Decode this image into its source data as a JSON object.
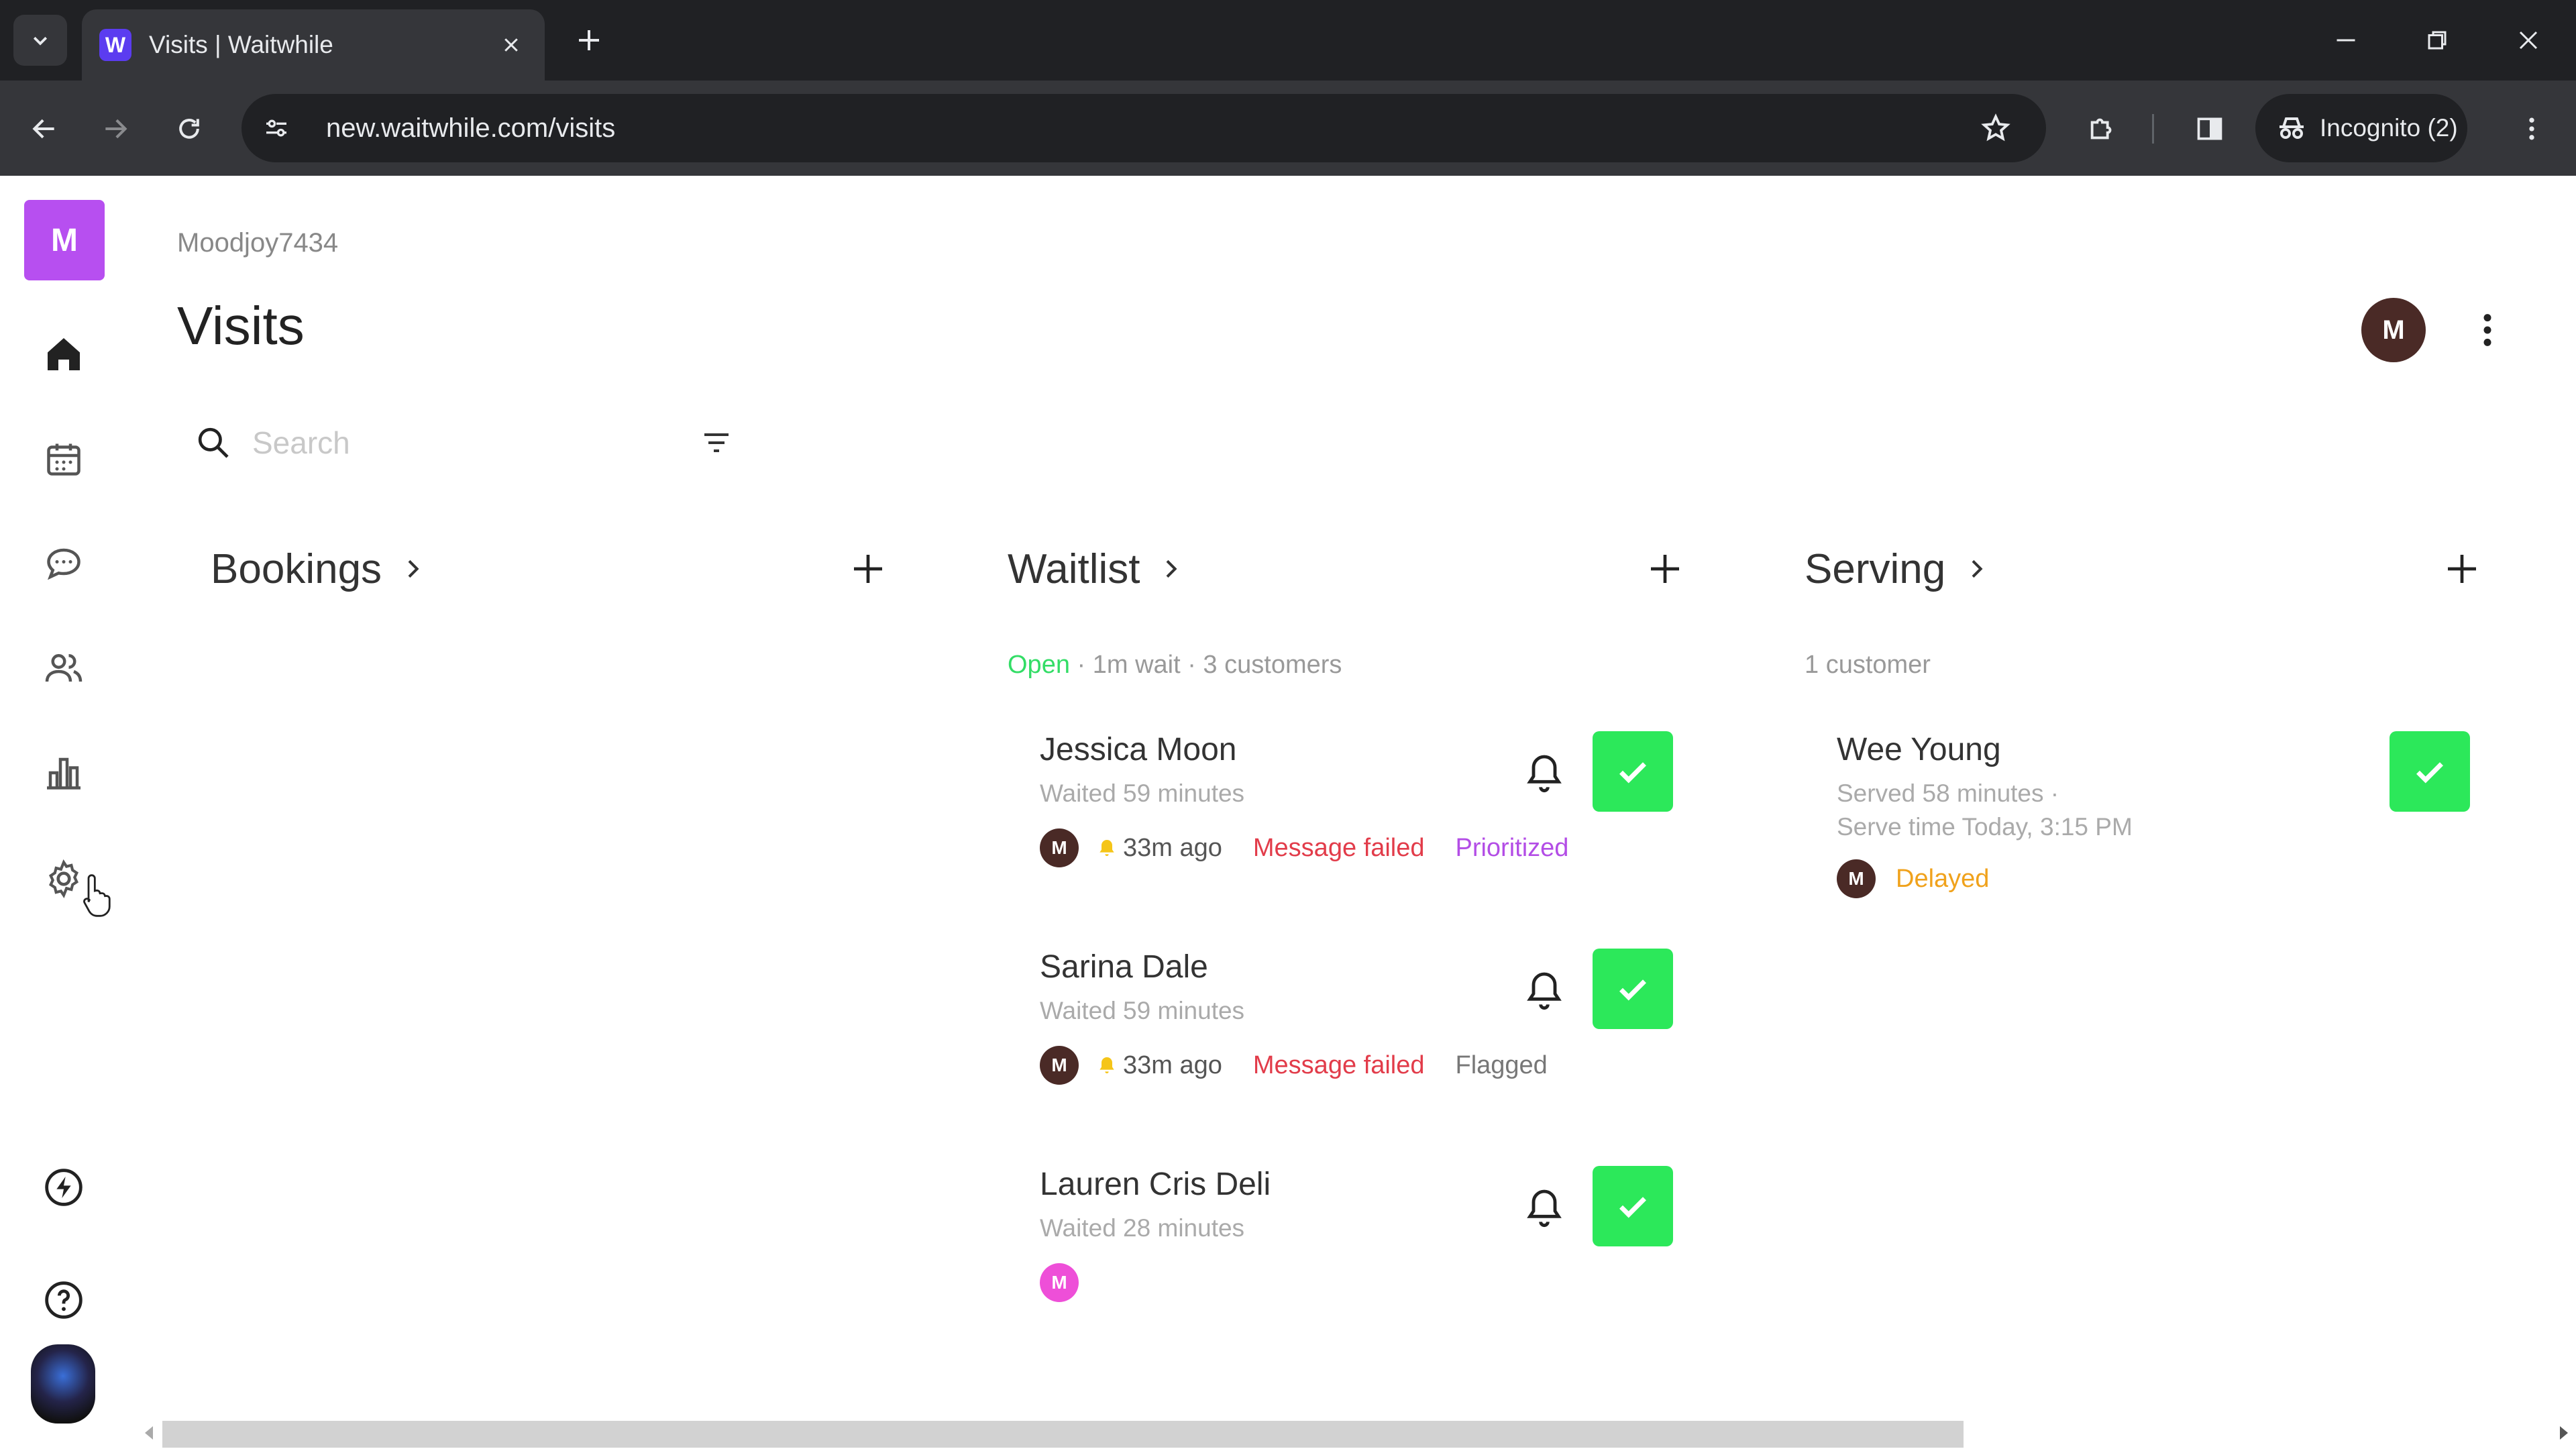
{
  "browser": {
    "tab_title": "Visits | Waitwhile",
    "favicon_letter": "W",
    "url": "new.waitwhile.com/visits",
    "incognito_label": "Incognito (2)"
  },
  "sidebar": {
    "brand_letter": "M",
    "items": [
      {
        "name": "home-icon"
      },
      {
        "name": "calendar-icon"
      },
      {
        "name": "chat-icon"
      },
      {
        "name": "customers-icon"
      },
      {
        "name": "analytics-icon"
      },
      {
        "name": "settings-icon"
      },
      {
        "name": "bolt-icon"
      },
      {
        "name": "help-icon"
      }
    ]
  },
  "header": {
    "account": "Moodjoy7434",
    "title": "Visits",
    "user_initial": "M"
  },
  "search": {
    "placeholder": "Search"
  },
  "columns": {
    "bookings": {
      "title": "Bookings"
    },
    "waitlist": {
      "title": "Waitlist",
      "status": "Open",
      "meta": " · 1m wait · 3 customers"
    },
    "serving": {
      "title": "Serving",
      "meta": "1 customer"
    }
  },
  "waitlist_visits": [
    {
      "name": "Jessica Moon",
      "waited": "Waited 59 minutes",
      "initial": "M",
      "notified": "33m ago",
      "message": "Message failed",
      "tag": "Prioritized"
    },
    {
      "name": "Sarina Dale",
      "waited": "Waited 59 minutes",
      "initial": "M",
      "notified": "33m ago",
      "message": "Message failed",
      "tag": "Flagged"
    },
    {
      "name": "Lauren Cris Deli",
      "waited": "Waited 28 minutes",
      "initial": "M"
    }
  ],
  "serving_visits": [
    {
      "name": "Wee Young",
      "served": "Served 58 minutes ·",
      "serve_time": "Serve time Today, 3:15 PM",
      "initial": "M",
      "tag": "Delayed"
    }
  ],
  "colors": {
    "brand": "#b74ff0",
    "check": "#2ce85a",
    "open": "#33dd66",
    "failed": "#e23c4a",
    "prioritized": "#b34de6",
    "delayed": "#f0a21c"
  }
}
